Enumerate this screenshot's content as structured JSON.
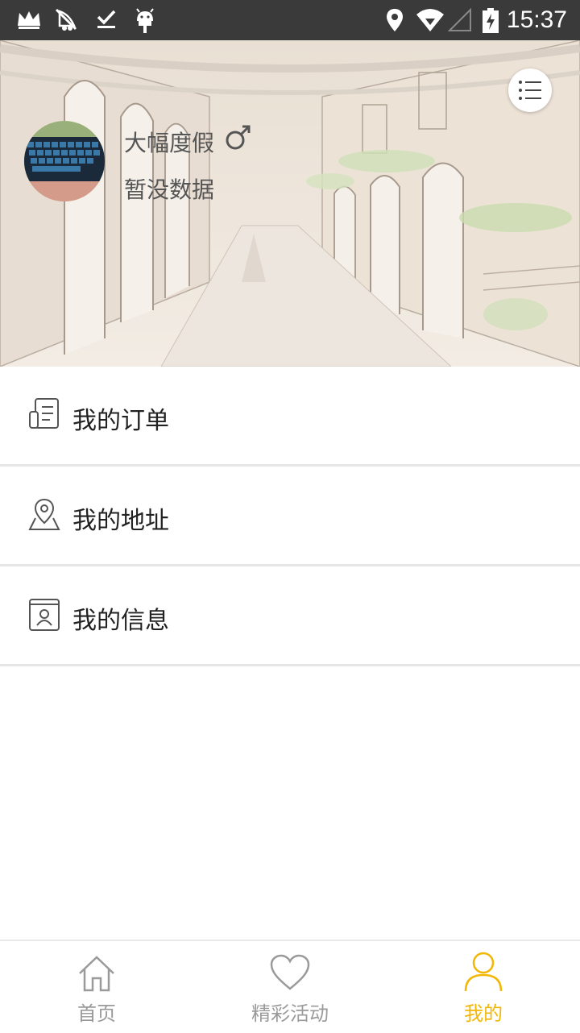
{
  "status_bar": {
    "time": "15:37",
    "left_icons": [
      "crown-icon",
      "notification-icon",
      "download-done-icon",
      "android-icon"
    ],
    "right_icons": [
      "location-icon",
      "wifi-icon",
      "signal-icon",
      "battery-charging-icon"
    ]
  },
  "profile": {
    "name": "大幅度假",
    "gender": "male",
    "subtitle": "暂没数据",
    "menu_icon": "list-menu-icon"
  },
  "menu_items": [
    {
      "label": "我的订单",
      "icon": "order-document-icon"
    },
    {
      "label": "我的地址",
      "icon": "map-location-icon"
    },
    {
      "label": "我的信息",
      "icon": "contact-card-icon"
    }
  ],
  "bottom_nav": {
    "items": [
      {
        "label": "首页",
        "icon": "home-icon",
        "active": false
      },
      {
        "label": "精彩活动",
        "icon": "heart-icon",
        "active": false
      },
      {
        "label": "我的",
        "icon": "user-icon",
        "active": true
      }
    ],
    "active_color": "#f2b705",
    "inactive_color": "#9a9a9a"
  }
}
